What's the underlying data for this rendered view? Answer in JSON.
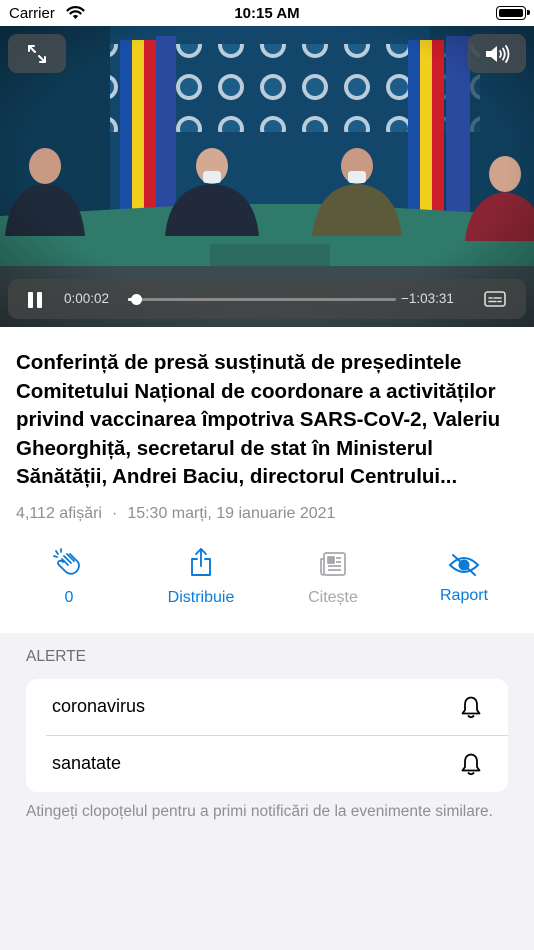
{
  "status_bar": {
    "carrier": "Carrier",
    "time": "10:15 AM"
  },
  "player": {
    "time_elapsed": "0:00:02",
    "time_remaining": "−1:03:31",
    "progress_fraction": 0.03,
    "state": "playing"
  },
  "video": {
    "title": "Conferință de presă susținută de președintele Comitetului Național de coordonare a activităților privind vaccinarea împotriva SARS-CoV-2, Valeriu Gheorghiță, secretarul de stat în Ministerul Sănătății, Andrei Baciu, directorul Centrului...",
    "views": "4,112 afișări",
    "separator": "·",
    "published": "15:30 marți, 19 ianuarie 2021"
  },
  "actions": [
    {
      "icon": "clapping-hands-icon",
      "label": "0",
      "enabled": true
    },
    {
      "icon": "share-icon",
      "label": "Distribuie",
      "enabled": true
    },
    {
      "icon": "newspaper-icon",
      "label": "Citește",
      "enabled": false
    },
    {
      "icon": "eye-slash-icon",
      "label": "Raport",
      "enabled": true
    }
  ],
  "alerts": {
    "header": "ALERTE",
    "items": [
      {
        "label": "coronavirus",
        "icon": "bell-icon"
      },
      {
        "label": "sanatate",
        "icon": "bell-icon"
      }
    ],
    "footnote": "Atingeți clopoțelul pentru a primi notificări de la evenimente similare."
  },
  "colors": {
    "accent": "#0a7bd9",
    "disabled": "#a6a6ab",
    "background": "#f2f2f7"
  }
}
